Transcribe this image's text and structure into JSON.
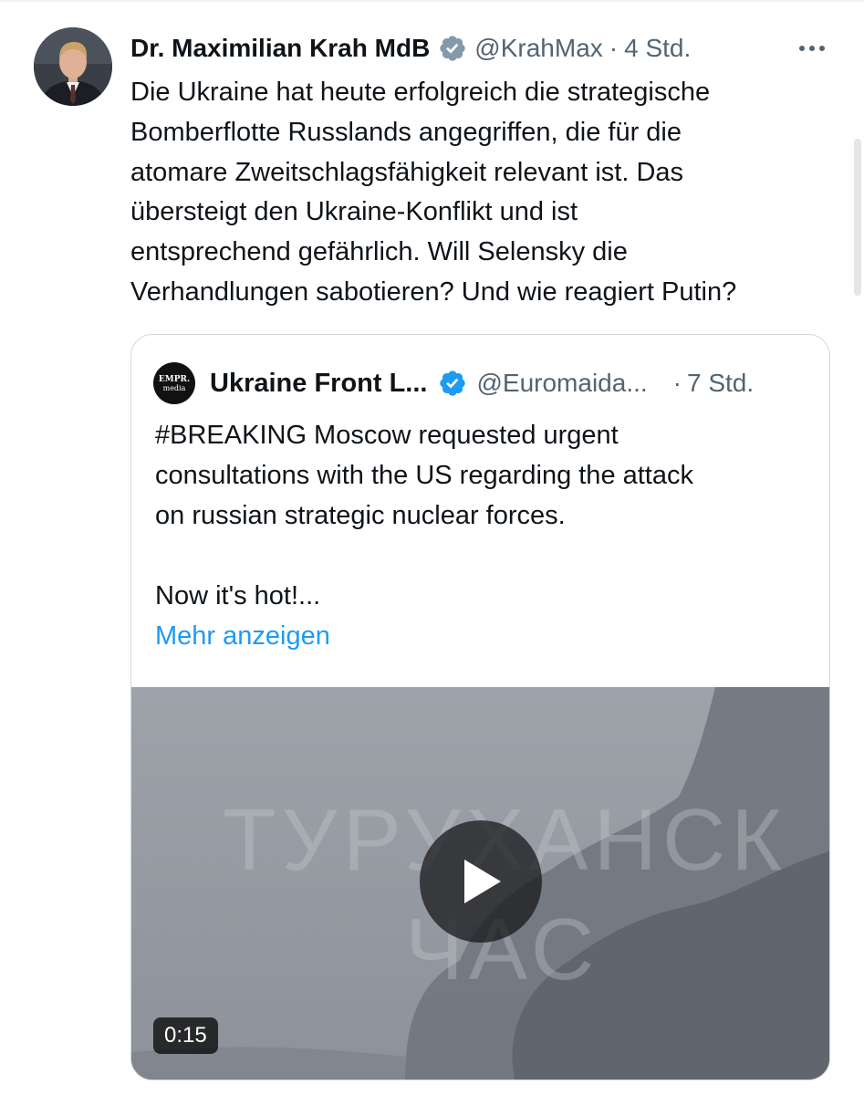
{
  "tweet": {
    "author_name": "Dr. Maximilian Krah MdB",
    "handle": "@KrahMax",
    "separator": "·",
    "timestamp": "4 Std.",
    "text": "Die Ukraine hat heute erfolgreich die strategische\nBomberflotte Russlands angegriffen, die für die\natomare Zweitschlagsfähigkeit relevant ist. Das\nübersteigt den Ukraine-Konflikt und ist\nentsprechend gefährlich. Will Selensky die\nVerhandlungen sabotieren? Und wie reagiert Putin?"
  },
  "quoted_tweet": {
    "avatar_line1": "EMPR.",
    "avatar_line2": "media",
    "author_name": "Ukraine Front L...",
    "handle": "@Euromaida...",
    "separator": "·",
    "timestamp": "7 Std.",
    "text": "#BREAKING Moscow requested urgent\nconsultations with the US regarding the attack\non russian strategic nuclear forces.\n\nNow it's hot!...",
    "show_more_label": "Mehr anzeigen",
    "video": {
      "duration": "0:15",
      "overlay_text_line1": "ТУРУХАНСК",
      "overlay_text_line2": "ЧАС"
    }
  },
  "icons": {
    "verified": "verified-badge-icon",
    "more": "more-horizontal-icon",
    "play": "play-icon"
  },
  "colors": {
    "primary_text": "#0f1419",
    "secondary_text": "#536471",
    "link": "#1d9bf0",
    "verified": "#1d9bf0",
    "verified_gray": "#829aab",
    "border": "#cfd9de"
  }
}
